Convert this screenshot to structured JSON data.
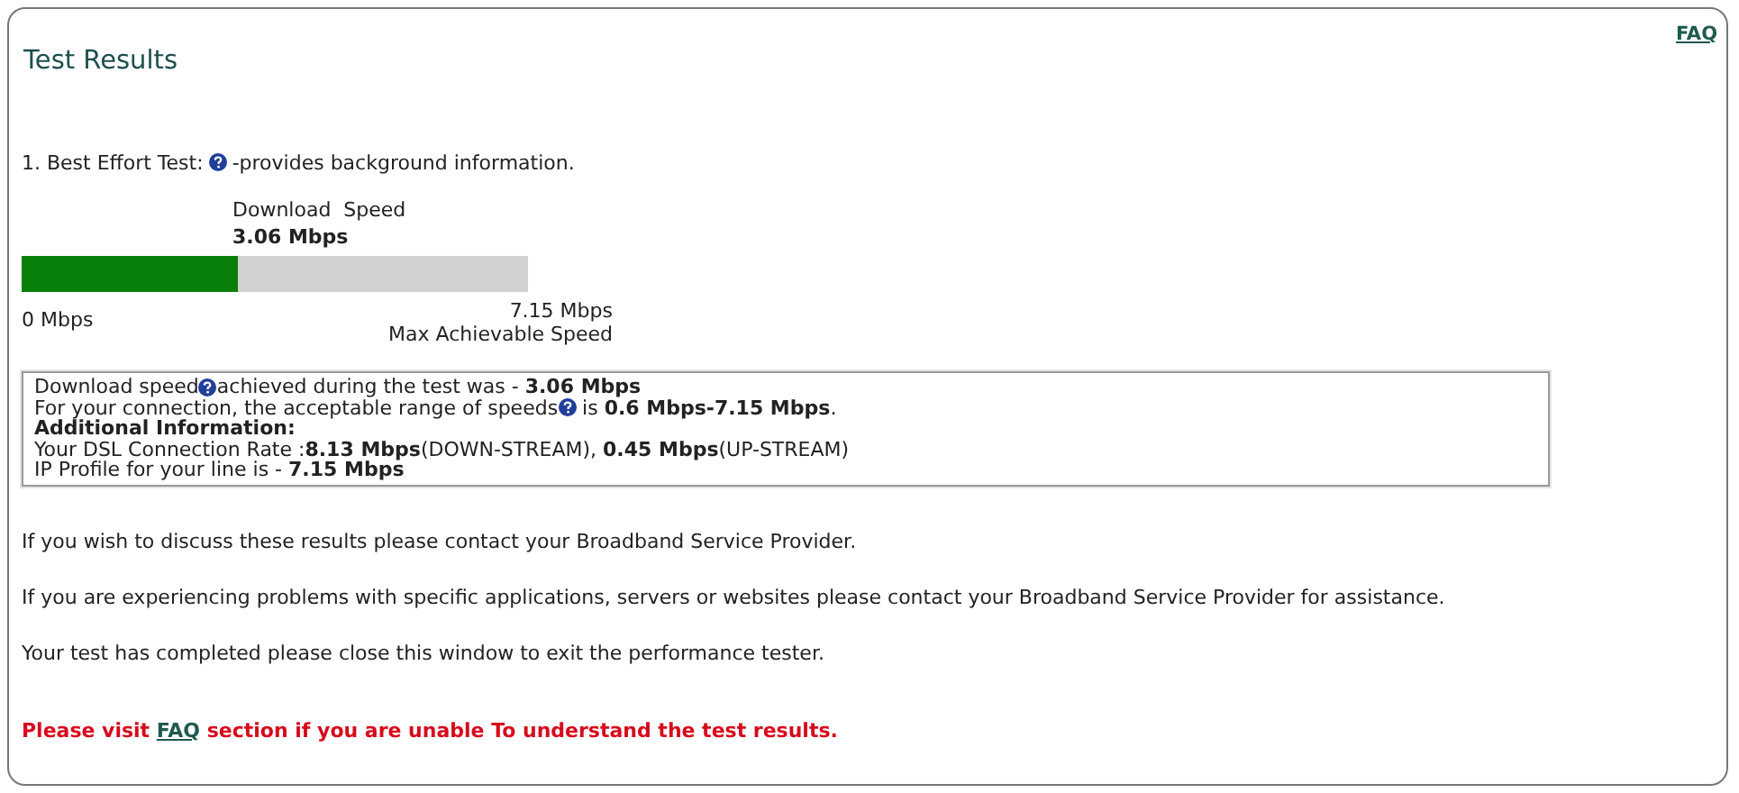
{
  "faq_link": "FAQ",
  "title": "Test Results",
  "test": [
    {
      "kind": "text",
      "text": "1. Best Effort Test:"
    },
    {
      "kind": "help_icon"
    },
    {
      "kind": "text",
      "text": "-provides background information."
    }
  ],
  "meter": {
    "heading": "Download  Speed",
    "value": "3.06 Mbps",
    "level": 0.428,
    "min_label": "0 Mbps",
    "max_label": "7.15 Mbps",
    "max_caption": "Max Achievable Speed"
  },
  "info": [
    [
      {
        "kind": "text",
        "text": "Download speed"
      },
      {
        "kind": "help_icon"
      },
      {
        "kind": "text",
        "text": "achieved during the test was - **3.06 Mbps**"
      }
    ],
    [
      {
        "kind": "text",
        "text": "For your connection, the acceptable range of speeds"
      },
      {
        "kind": "help_icon"
      },
      {
        "kind": "text",
        "text": " is **0.6 Mbps-7.15 Mbps**."
      }
    ],
    [
      {
        "kind": "text",
        "text": "**Additional Information:**"
      }
    ],
    [
      {
        "kind": "text",
        "text": "Your DSL Connection Rate :**8.13 Mbps**(DOWN-STREAM), **0.45 Mbps**(UP-STREAM)"
      }
    ],
    [
      {
        "kind": "text",
        "text": "IP Profile for your line is - **7.15 Mbps**"
      }
    ]
  ],
  "messages": [
    "If you wish to discuss these results please contact your Broadband Service Provider.",
    "If you are experiencing problems with specific applications, servers or websites please contact your Broadband Service Provider for assistance.",
    "Your test has completed please close this window to exit the performance tester."
  ],
  "notice": {
    "before": "Please visit ",
    "link": "FAQ",
    "after": " section if you are unable To understand the test results."
  }
}
